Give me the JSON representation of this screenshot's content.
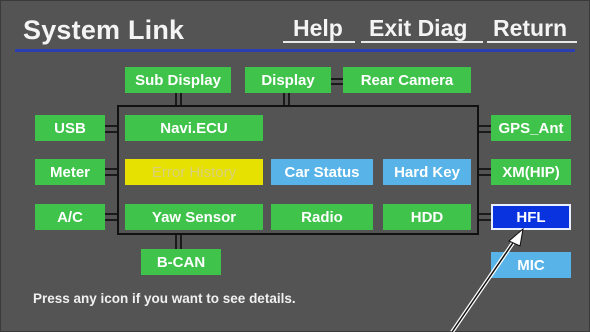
{
  "header": {
    "title": "System Link",
    "help_label": "Help",
    "exit_diag_label": "Exit Diag",
    "return_label": "Return"
  },
  "top_row": {
    "sub_display": "Sub Display",
    "display": "Display",
    "rear_camera": "Rear Camera"
  },
  "left_column": {
    "usb": "USB",
    "meter": "Meter",
    "ac": "A/C"
  },
  "center": {
    "navi_ecu": "Navi.ECU",
    "error_history": "Error History",
    "car_status": "Car Status",
    "hard_key": "Hard Key",
    "yaw_sensor": "Yaw Sensor",
    "radio": "Radio",
    "hdd": "HDD"
  },
  "right_column": {
    "gps_ant": "GPS_Ant",
    "xm_hip": "XM(HIP)",
    "hfl": "HFL",
    "mic": "MIC"
  },
  "bottom": {
    "b_can": "B-CAN"
  },
  "hint_text": "Press any icon if you want to see details.",
  "colors": {
    "screen_bg": "#545454",
    "node_green": "#3fc34a",
    "node_blue": "#58b4e8",
    "node_yellow": "#e6e100",
    "node_selected": "#0a33e0",
    "title_rule": "#2b3fb2"
  },
  "selected_node": "HFL"
}
